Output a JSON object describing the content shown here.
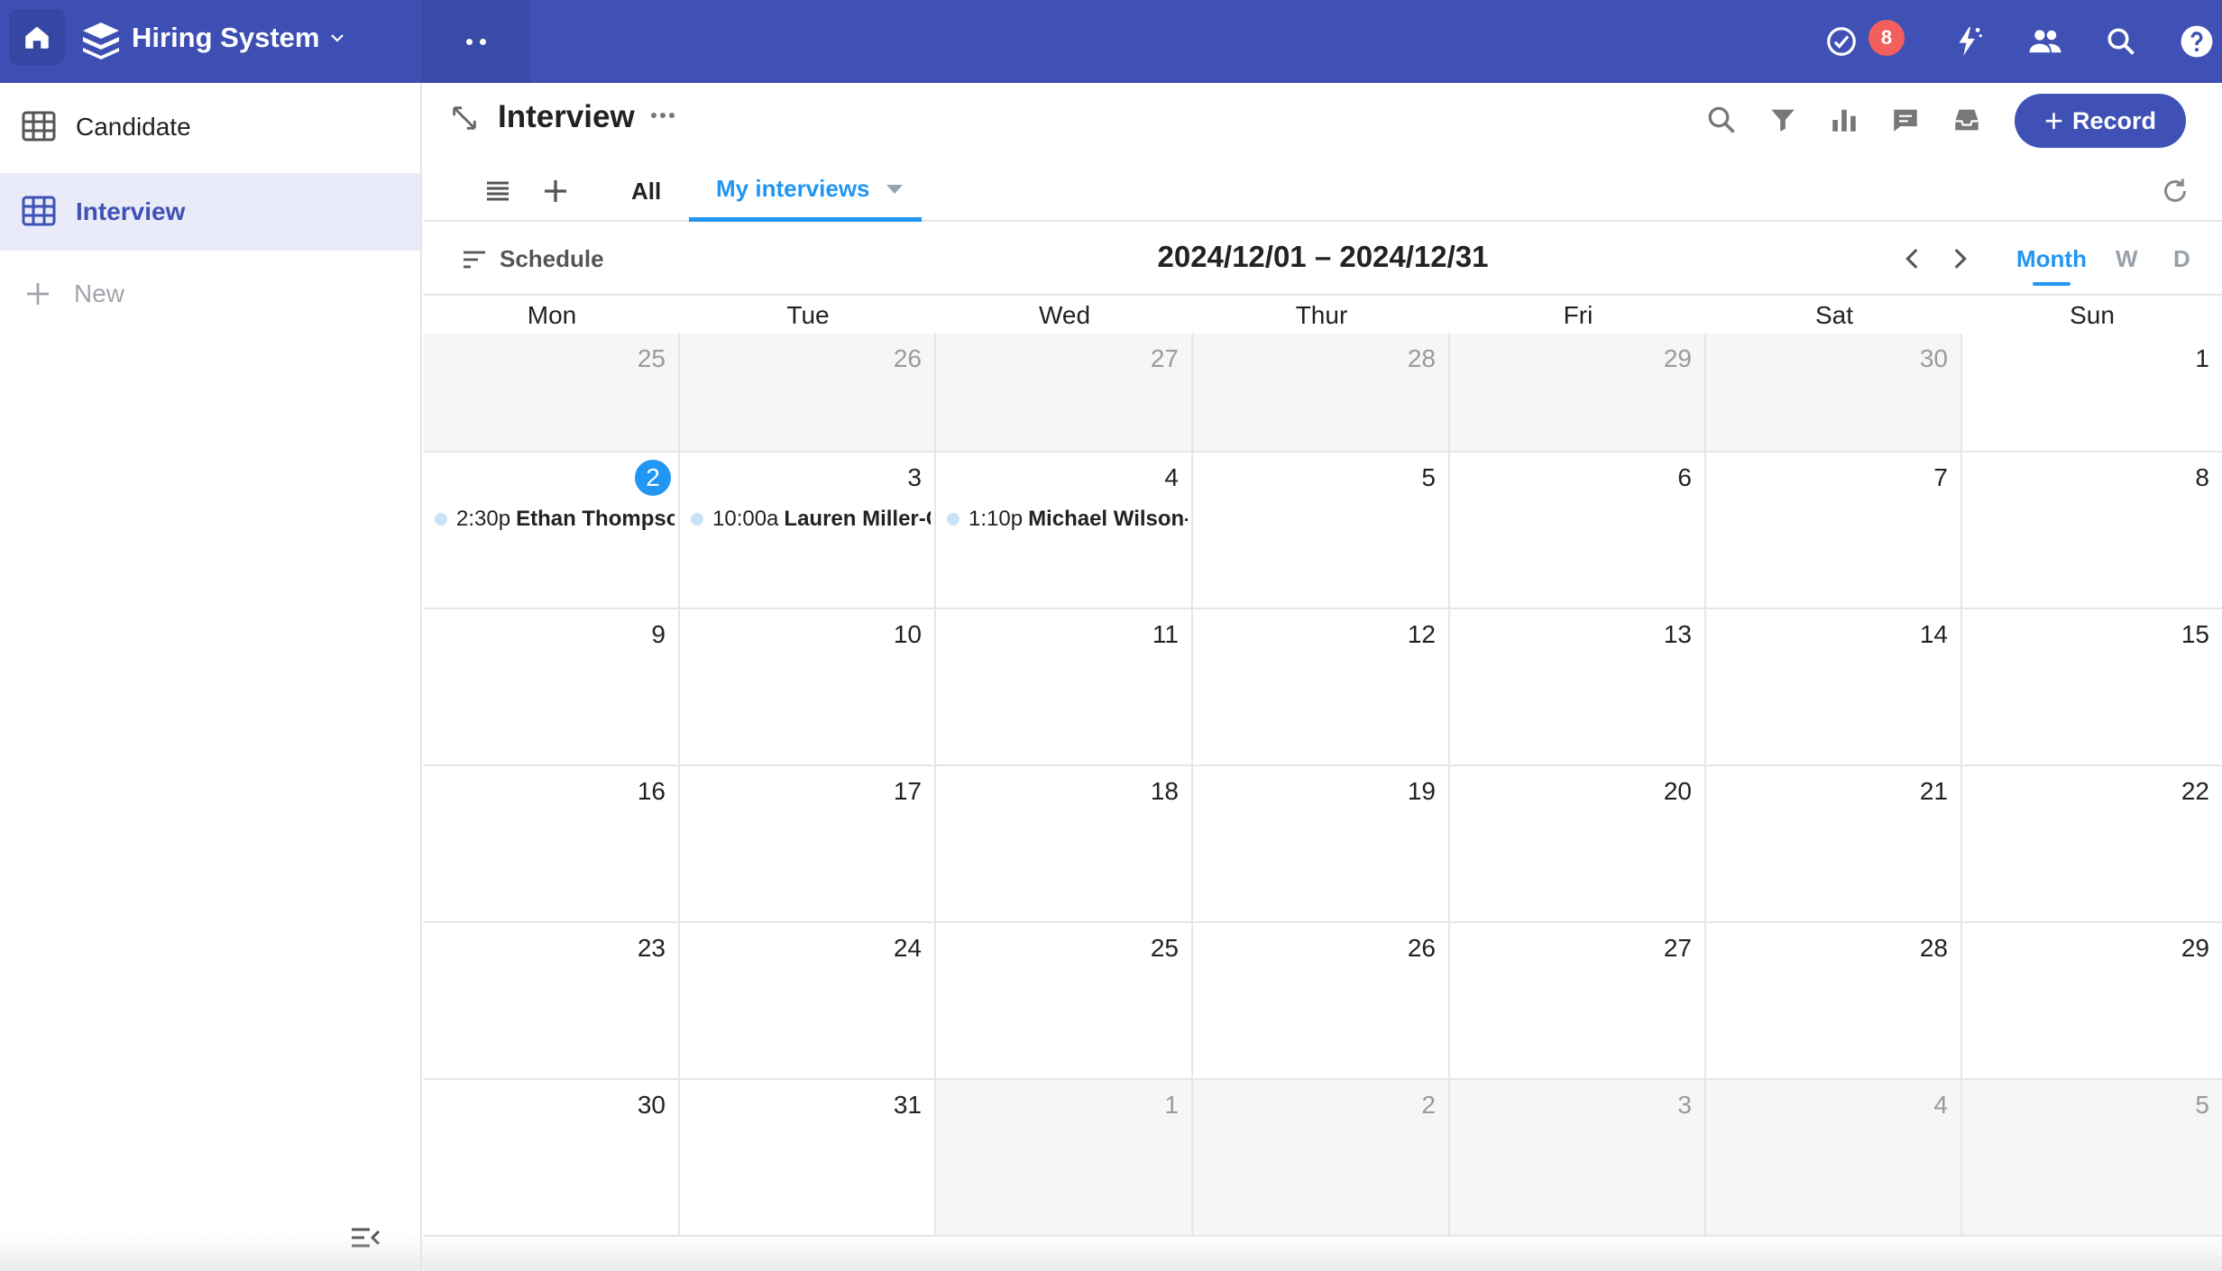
{
  "topbar": {
    "base_name": "Hiring System",
    "notification_count": "8",
    "accent": "#3f51b5"
  },
  "sidebar": {
    "items": [
      {
        "label": "Candidate",
        "icon": "table-icon",
        "active": false
      },
      {
        "label": "Interview",
        "icon": "table-icon",
        "active": true
      }
    ],
    "new_label": "New"
  },
  "main": {
    "table_title": "Interview",
    "record_button": "Record",
    "views": {
      "all_label": "All",
      "current_label": "My interviews"
    }
  },
  "calendar": {
    "schedule_label": "Schedule",
    "range_label": "2024/12/01 – 2024/12/31",
    "modes": {
      "month": "Month",
      "week": "W",
      "day": "D"
    },
    "weekdays": [
      "Mon",
      "Tue",
      "Wed",
      "Thur",
      "Fri",
      "Sat",
      "Sun"
    ],
    "today": "2",
    "weeks": [
      [
        {
          "d": "25",
          "other": true
        },
        {
          "d": "26",
          "other": true
        },
        {
          "d": "27",
          "other": true
        },
        {
          "d": "28",
          "other": true
        },
        {
          "d": "29",
          "other": true
        },
        {
          "d": "30",
          "other": true
        },
        {
          "d": "1",
          "other": false
        }
      ],
      [
        {
          "d": "2",
          "other": false,
          "today": true,
          "event": {
            "time": "2:30p",
            "name": "Ethan Thompson"
          }
        },
        {
          "d": "3",
          "other": false,
          "event": {
            "time": "10:00a",
            "name": "Lauren Miller-C"
          }
        },
        {
          "d": "4",
          "other": false,
          "event": {
            "time": "1:10p",
            "name": "Michael Wilson-"
          }
        },
        {
          "d": "5",
          "other": false
        },
        {
          "d": "6",
          "other": false
        },
        {
          "d": "7",
          "other": false
        },
        {
          "d": "8",
          "other": false
        }
      ],
      [
        {
          "d": "9",
          "other": false
        },
        {
          "d": "10",
          "other": false
        },
        {
          "d": "11",
          "other": false
        },
        {
          "d": "12",
          "other": false
        },
        {
          "d": "13",
          "other": false
        },
        {
          "d": "14",
          "other": false
        },
        {
          "d": "15",
          "other": false
        }
      ],
      [
        {
          "d": "16",
          "other": false
        },
        {
          "d": "17",
          "other": false
        },
        {
          "d": "18",
          "other": false
        },
        {
          "d": "19",
          "other": false
        },
        {
          "d": "20",
          "other": false
        },
        {
          "d": "21",
          "other": false
        },
        {
          "d": "22",
          "other": false
        }
      ],
      [
        {
          "d": "23",
          "other": false
        },
        {
          "d": "24",
          "other": false
        },
        {
          "d": "25",
          "other": false
        },
        {
          "d": "26",
          "other": false
        },
        {
          "d": "27",
          "other": false
        },
        {
          "d": "28",
          "other": false
        },
        {
          "d": "29",
          "other": false
        }
      ],
      [
        {
          "d": "30",
          "other": false
        },
        {
          "d": "31",
          "other": false
        },
        {
          "d": "1",
          "other": true
        },
        {
          "d": "2",
          "other": true
        },
        {
          "d": "3",
          "other": true
        },
        {
          "d": "4",
          "other": true
        },
        {
          "d": "5",
          "other": true
        }
      ]
    ]
  }
}
